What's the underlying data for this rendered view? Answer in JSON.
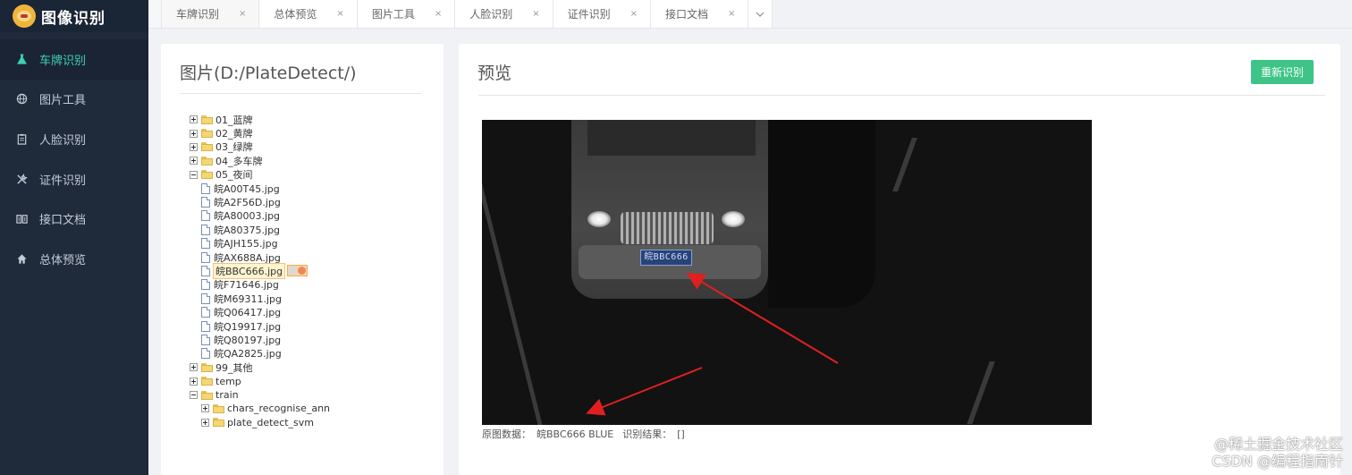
{
  "app": {
    "title": "图像识别"
  },
  "sidebar": {
    "items": [
      {
        "label": "车牌识别",
        "icon": "flask-icon",
        "active": true
      },
      {
        "label": "图片工具",
        "icon": "globe-icon",
        "active": false
      },
      {
        "label": "人脸识别",
        "icon": "clipboard-icon",
        "active": false
      },
      {
        "label": "证件识别",
        "icon": "tools-icon",
        "active": false
      },
      {
        "label": "接口文档",
        "icon": "book-icon",
        "active": false
      },
      {
        "label": "总体预览",
        "icon": "home-icon",
        "active": false
      }
    ]
  },
  "tabs": [
    {
      "label": "车牌识别",
      "close": "×"
    },
    {
      "label": "总体预览",
      "close": "×"
    },
    {
      "label": "图片工具",
      "close": "×"
    },
    {
      "label": "人脸识别",
      "close": "×"
    },
    {
      "label": "证件识别",
      "close": "×"
    },
    {
      "label": "接口文档",
      "close": "×"
    }
  ],
  "tree_panel": {
    "title": "图片(D:/PlateDetect/)",
    "folders_top": [
      "01_蓝牌",
      "02_黄牌",
      "03_绿牌",
      "04_多车牌"
    ],
    "open_folder": "05_夜间",
    "files": [
      "皖A00T45.jpg",
      "皖A2F56D.jpg",
      "皖A80003.jpg",
      "皖A80375.jpg",
      "皖AJH155.jpg",
      "皖AX688A.jpg",
      "皖BBC666.jpg",
      "皖F71646.jpg",
      "皖M69311.jpg",
      "皖Q06417.jpg",
      "皖Q19917.jpg",
      "皖Q80197.jpg",
      "皖QA2825.jpg"
    ],
    "selected_file": "皖BBC666.jpg",
    "folders_after": [
      "99_其他",
      "temp"
    ],
    "train_folder": "train",
    "train_children": [
      "chars_recognise_ann",
      "plate_detect_svm"
    ]
  },
  "preview": {
    "title": "预览",
    "button": "重新识别",
    "plate_text": "皖BBC666",
    "caption_original_label": "原图数据：",
    "caption_original_value": "皖BBC666 BLUE",
    "caption_result_label": "识别结果：",
    "caption_result_value": "[]"
  },
  "watermark": {
    "line1": "@稀土掘金技术社区",
    "line2": "CSDN @编程指南针"
  },
  "colors": {
    "sidebar_bg": "#1f2a3b",
    "active_menu": "#3fcfb5",
    "button_green": "#3ec486",
    "arrow_red": "#e02020"
  }
}
